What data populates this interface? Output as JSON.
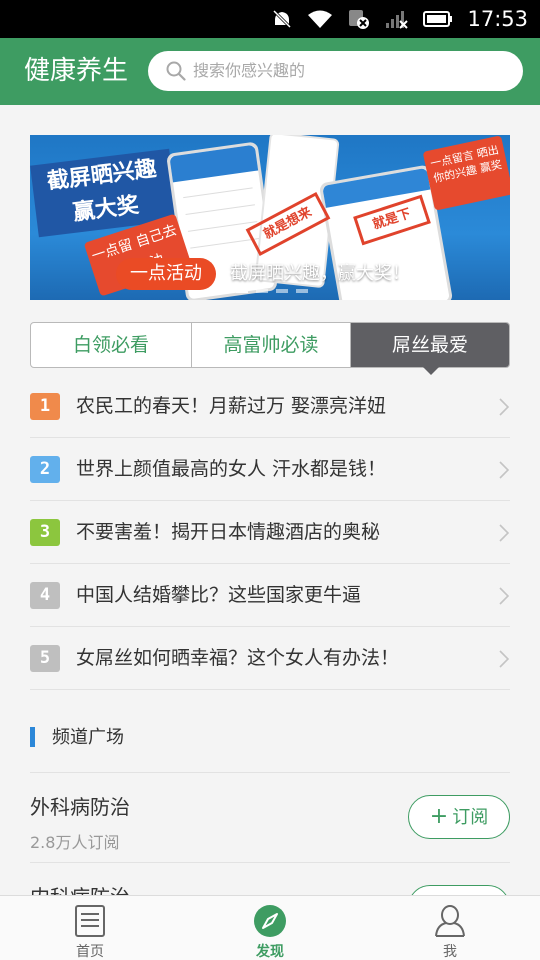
{
  "status_bar": {
    "time": "17:53",
    "icons": [
      "mute-icon",
      "wifi-icon",
      "sim-card-no-signal-icon",
      "signal-off-icon",
      "battery-icon"
    ]
  },
  "header": {
    "title": "健康养生",
    "search_placeholder": "搜索你感兴趣的",
    "background_color": "#3e9c62"
  },
  "banner": {
    "headline_line1": "截屏晒兴趣",
    "headline_line2": "赢大奖",
    "badge": "一点活动",
    "caption": "截屏晒兴趣，赢大奖！",
    "tag_text": "一点留 自己去留 加油",
    "stamp_a": "就是想来",
    "stamp_b": "就是下",
    "note_text": "一点留言 晒出 你的兴趣 赢奖",
    "dots": 4,
    "active_dot": 0
  },
  "segment_tabs": [
    {
      "label": "白领必看",
      "selected": false
    },
    {
      "label": "高富帅必读",
      "selected": false
    },
    {
      "label": "屌丝最爱",
      "selected": true
    }
  ],
  "rank_list": [
    {
      "rank": "1",
      "color": "#f08a4b",
      "title": "农民工的春天！月薪过万 娶漂亮洋妞"
    },
    {
      "rank": "2",
      "color": "#62b0ec",
      "title": "世界上颜值最高的女人 汗水都是钱！"
    },
    {
      "rank": "3",
      "color": "#8cc63e",
      "title": "不要害羞！揭开日本情趣酒店的奥秘"
    },
    {
      "rank": "4",
      "color": "#bfbfbf",
      "title": "中国人结婚攀比？这些国家更牛逼"
    },
    {
      "rank": "5",
      "color": "#bfbfbf",
      "title": "女屌丝如何晒幸福？这个女人有办法！"
    }
  ],
  "section": {
    "title": "频道广场"
  },
  "channels": [
    {
      "name": "外科病防治",
      "subscribers": "2.8万人订阅",
      "button": "订阅"
    },
    {
      "name": "内科病防治",
      "subscribers": "",
      "button": "订阅"
    }
  ],
  "bottom_nav": [
    {
      "label": "首页",
      "icon": "document-icon",
      "active": false
    },
    {
      "label": "发现",
      "icon": "compass-icon",
      "active": true
    },
    {
      "label": "我",
      "icon": "user-icon",
      "active": false
    }
  ]
}
